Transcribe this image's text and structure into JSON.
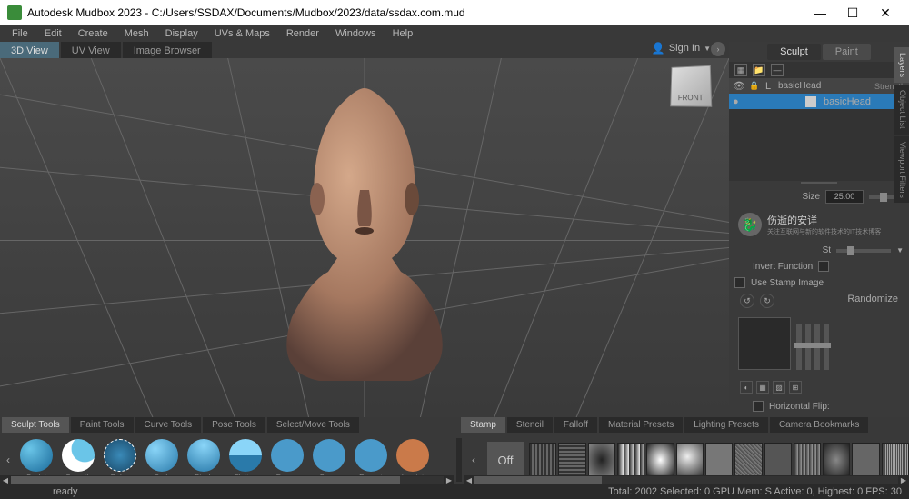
{
  "title": "Autodesk Mudbox 2023 - C:/Users/SSDAX/Documents/Mudbox/2023/data/ssdax.com.mud",
  "menu": [
    "File",
    "Edit",
    "Create",
    "Mesh",
    "Display",
    "UVs & Maps",
    "Render",
    "Windows",
    "Help"
  ],
  "signin": "Sign In",
  "viewtabs": [
    {
      "label": "3D View",
      "active": true
    },
    {
      "label": "UV View",
      "active": false
    },
    {
      "label": "Image Browser",
      "active": false
    }
  ],
  "viewcube": "FRONT",
  "rtabs": [
    {
      "label": "Sculpt",
      "active": true
    },
    {
      "label": "Paint",
      "active": false
    }
  ],
  "sidelabels": [
    {
      "label": "Layers",
      "active": true
    },
    {
      "label": "Object List",
      "active": false
    },
    {
      "label": "Viewport Filters",
      "active": false
    }
  ],
  "layer_root": {
    "name": "basicHead",
    "strength": "Strength"
  },
  "layer_child": {
    "name": "basicHead"
  },
  "props": {
    "size_label": "Size",
    "size_val": "25.00",
    "st_label": "St",
    "invert": "Invert Function",
    "usestamp": "Use Stamp Image",
    "randomize": "Randomize",
    "hflip": "Horizontal Flip:"
  },
  "watermark": {
    "title": "伤逝的安详",
    "sub": "关注互联网与新的软件技术的IT技术博客"
  },
  "ltabs": [
    {
      "label": "Sculpt Tools",
      "active": true
    },
    {
      "label": "Paint Tools"
    },
    {
      "label": "Curve Tools"
    },
    {
      "label": "Pose Tools"
    },
    {
      "label": "Select/Move Tools"
    }
  ],
  "rtabs2": [
    {
      "label": "Stamp",
      "active": true
    },
    {
      "label": "Stencil"
    },
    {
      "label": "Falloff"
    },
    {
      "label": "Material Presets"
    },
    {
      "label": "Lighting Presets"
    },
    {
      "label": "Camera Bookmarks"
    }
  ],
  "tools": [
    "Sculpt",
    "Smooth",
    "Relax",
    "Grab",
    "Pinch",
    "Flatten",
    "Foamy",
    "Spray",
    "Repeat",
    "Imprint"
  ],
  "off": "Off",
  "status": {
    "ready": "ready",
    "stats": "Total: 2002  Selected: 0 GPU Mem: S   Active: 0, Highest: 0   FPS: 30"
  }
}
